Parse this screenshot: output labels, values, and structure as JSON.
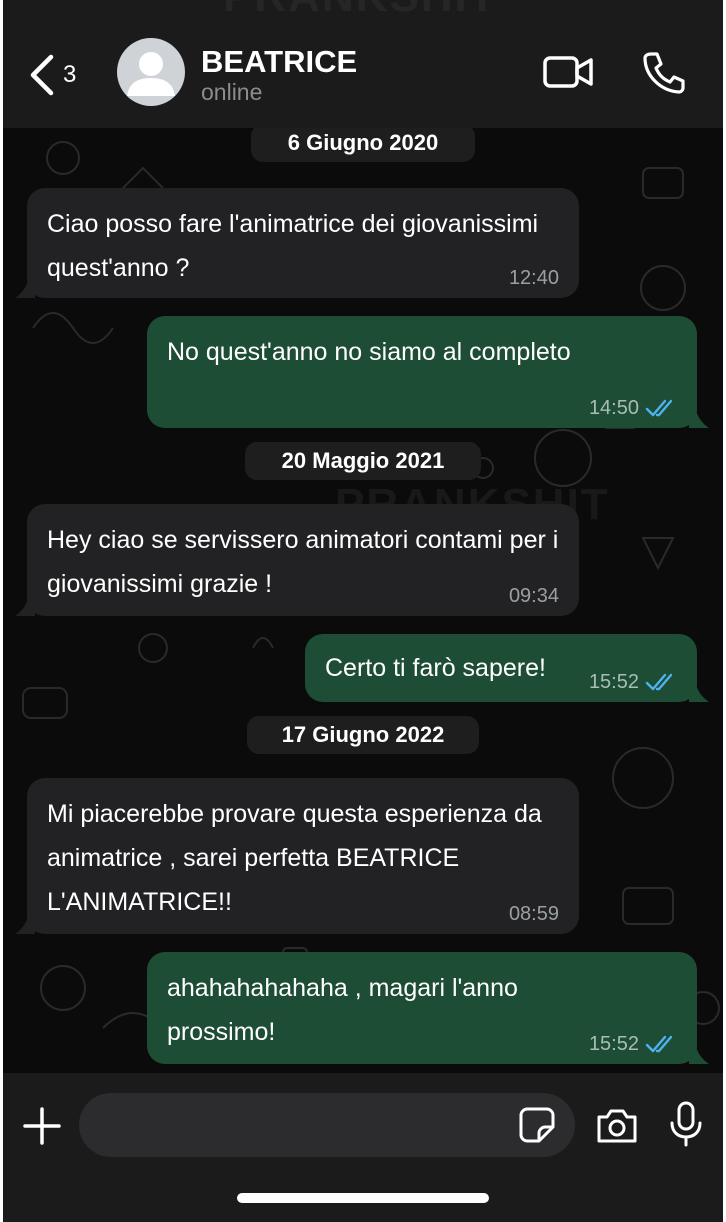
{
  "header": {
    "back_count": "3",
    "contact_name": "BEATRICE",
    "contact_status": "online",
    "watermark": "PRANKSHIT"
  },
  "chat": {
    "watermark": "PRANKSHIT",
    "items": [
      {
        "type": "date",
        "text": "6 Giugno 2020"
      },
      {
        "type": "in",
        "text": "Ciao posso fare l'animatrice dei giovanissimi quest'anno ?",
        "time": "12:40"
      },
      {
        "type": "out",
        "text": "No quest'anno no siamo al completo",
        "time": "14:50",
        "status": "read"
      },
      {
        "type": "date",
        "text": "20 Maggio 2021"
      },
      {
        "type": "in",
        "text": "Hey ciao se servissero animatori contami per i giovanissimi grazie !",
        "time": "09:34"
      },
      {
        "type": "out",
        "text": "Certo ti farò sapere!",
        "time": "15:52",
        "status": "read"
      },
      {
        "type": "date",
        "text": "17 Giugno 2022"
      },
      {
        "type": "in",
        "text": "Mi piacerebbe provare questa esperienza da animatrice , sarei perfetta BEATRICE L'ANIMATRICE!!",
        "time": "08:59"
      },
      {
        "type": "out",
        "text": "ahahahahahaha , magari l'anno prossimo!",
        "time": "15:52",
        "status": "read"
      }
    ]
  },
  "composer": {
    "placeholder": ""
  },
  "colors": {
    "background": "#0b0b0b",
    "bar": "#1b1b1b",
    "incoming_bubble": "#222224",
    "outgoing_bubble": "#1e4d36",
    "read_ticks": "#4fb2f0"
  },
  "icons": [
    "chevron-left-icon",
    "avatar-icon",
    "video-call-icon",
    "phone-icon",
    "plus-icon",
    "sticker-icon",
    "camera-icon",
    "microphone-icon",
    "double-check-icon"
  ]
}
